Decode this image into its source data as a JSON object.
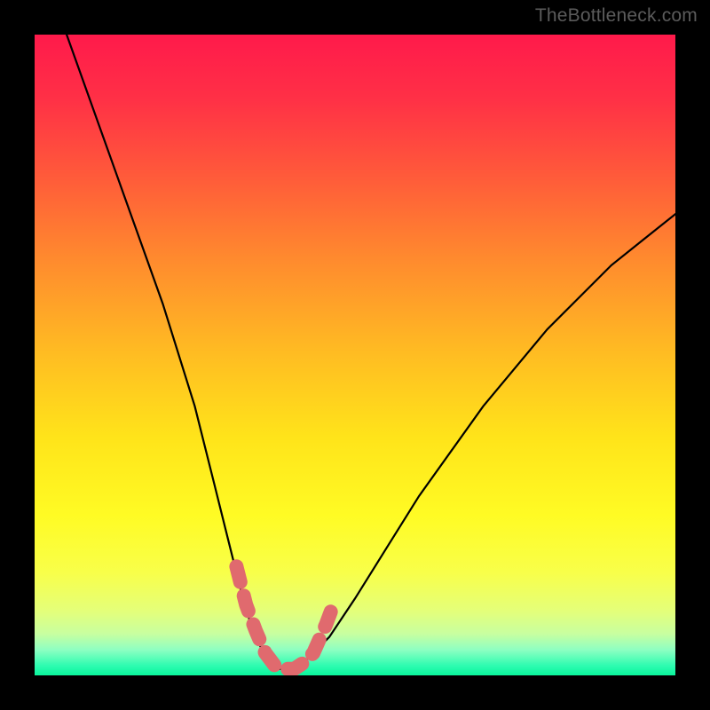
{
  "watermark": {
    "text": "TheBottleneck.com"
  },
  "gradient": {
    "stops": [
      {
        "offset": 0.0,
        "color": "#ff1a4b"
      },
      {
        "offset": 0.1,
        "color": "#ff3046"
      },
      {
        "offset": 0.22,
        "color": "#ff5a3a"
      },
      {
        "offset": 0.35,
        "color": "#ff8a2e"
      },
      {
        "offset": 0.5,
        "color": "#ffbd22"
      },
      {
        "offset": 0.63,
        "color": "#ffe41a"
      },
      {
        "offset": 0.75,
        "color": "#fffb24"
      },
      {
        "offset": 0.84,
        "color": "#f8ff4a"
      },
      {
        "offset": 0.9,
        "color": "#e4ff7a"
      },
      {
        "offset": 0.935,
        "color": "#c8ffa0"
      },
      {
        "offset": 0.96,
        "color": "#8effc2"
      },
      {
        "offset": 0.985,
        "color": "#2dfcb0"
      },
      {
        "offset": 1.0,
        "color": "#0af59c"
      }
    ]
  },
  "chart_data": {
    "type": "line",
    "title": "",
    "xlabel": "",
    "ylabel": "",
    "xlim": [
      0,
      100
    ],
    "ylim": [
      0,
      100
    ],
    "series": [
      {
        "name": "bottleneck-curve",
        "x": [
          5,
          10,
          15,
          20,
          25,
          28,
          30,
          32,
          34,
          36,
          38,
          40,
          42,
          46,
          50,
          55,
          60,
          65,
          70,
          75,
          80,
          85,
          90,
          95,
          100
        ],
        "y": [
          100,
          86,
          72,
          58,
          42,
          30,
          22,
          14,
          7,
          3,
          1,
          1,
          2,
          6,
          12,
          20,
          28,
          35,
          42,
          48,
          54,
          59,
          64,
          68,
          72
        ]
      },
      {
        "name": "highlight-region",
        "x": [
          31.5,
          33,
          34.5,
          36,
          37.5,
          39,
          40.5,
          42,
          43.5,
          45.5,
          47
        ],
        "y": [
          17,
          11,
          7,
          3.5,
          1.5,
          1,
          1,
          2,
          3.5,
          8,
          12
        ]
      }
    ],
    "annotations": []
  }
}
